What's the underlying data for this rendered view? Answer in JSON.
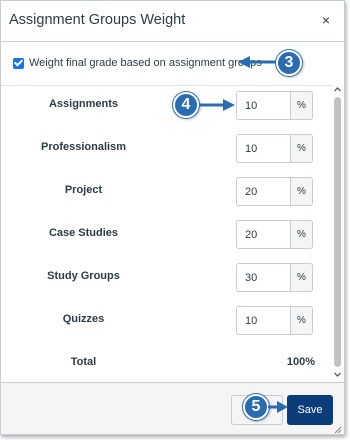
{
  "dialog": {
    "title": "Assignment Groups Weight",
    "close_glyph": "×",
    "weight_checkbox": {
      "label": "Weight final grade based on assignment groups",
      "checked": true
    },
    "groups": [
      {
        "name": "Assignments",
        "value": "10",
        "unit": "%"
      },
      {
        "name": "Professionalism",
        "value": "10",
        "unit": "%"
      },
      {
        "name": "Project",
        "value": "20",
        "unit": "%"
      },
      {
        "name": "Case Studies",
        "value": "20",
        "unit": "%"
      },
      {
        "name": "Study Groups",
        "value": "30",
        "unit": "%"
      },
      {
        "name": "Quizzes",
        "value": "10",
        "unit": "%"
      }
    ],
    "total": {
      "label": "Total",
      "value": "100%"
    },
    "footer": {
      "cancel_label": "",
      "save_label": "Save"
    }
  },
  "callouts": {
    "c3": "3",
    "c4": "4",
    "c5": "5"
  },
  "colors": {
    "accent": "#0a3d7a",
    "callout": "#2b6cb0",
    "checkbox": "#1a73e8"
  },
  "icons": {
    "close": "close-icon",
    "scroll_up": "chevron-up-icon",
    "scroll_down": "chevron-down-icon",
    "resize": "resize-grip-icon"
  }
}
